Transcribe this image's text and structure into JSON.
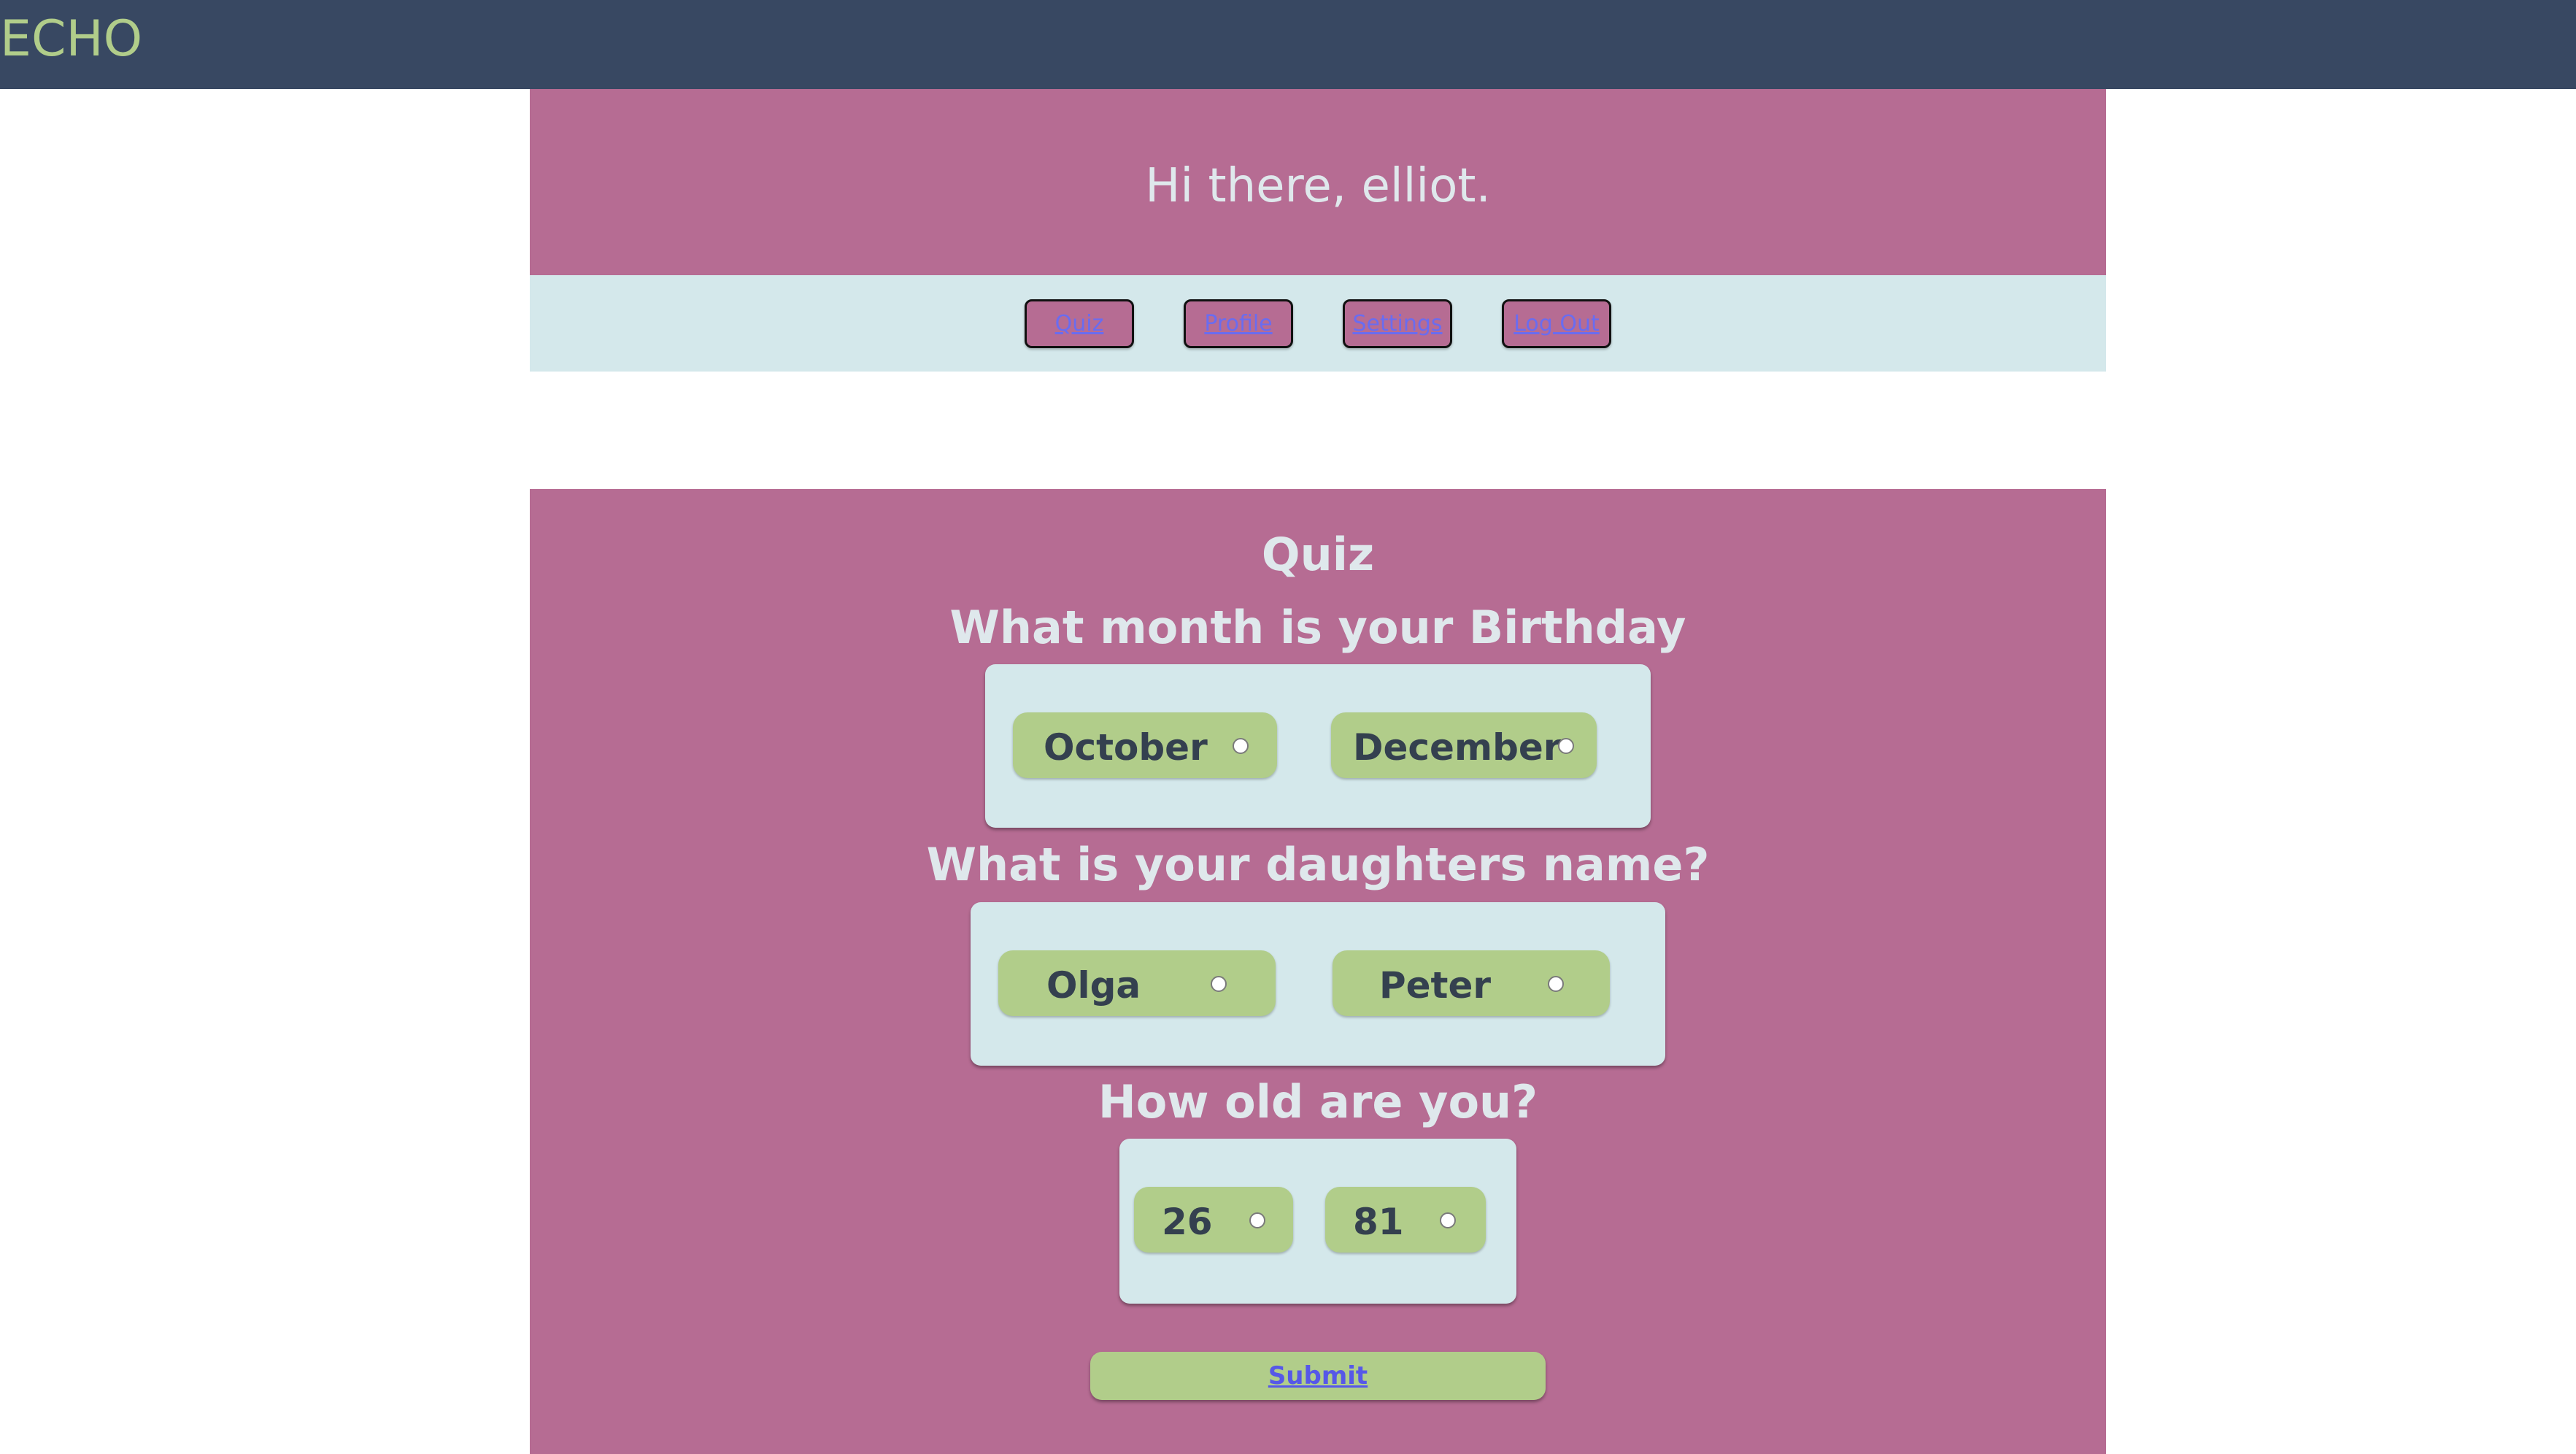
{
  "app": {
    "brand": "ECHO"
  },
  "greeting": {
    "text": "Hi there, elliot."
  },
  "nav": {
    "items": [
      {
        "label": "Quiz"
      },
      {
        "label": "Profile"
      },
      {
        "label": "Settings"
      },
      {
        "label": "Log Out"
      }
    ]
  },
  "quiz": {
    "title": "Quiz",
    "questions": [
      {
        "text": "What month is your Birthday",
        "options": [
          "October",
          "December"
        ]
      },
      {
        "text": "What is your daughters name?",
        "options": [
          "Olga",
          "Peter"
        ]
      },
      {
        "text": "How old are you?",
        "options": [
          "26",
          "81"
        ]
      }
    ],
    "submit_label": "Submit"
  },
  "colors": {
    "topbar": "#384862",
    "brand": "#b1cd8a",
    "panel": "#b66c93",
    "nav_bg": "#d4e8eb",
    "option": "#b1cd8a",
    "link": "#6a6cf0"
  }
}
